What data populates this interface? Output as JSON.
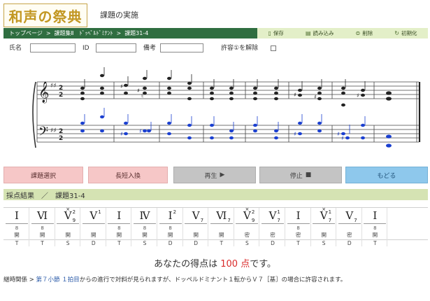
{
  "header": {
    "logo": "和声の祭典",
    "title": "課題の実施"
  },
  "breadcrumb": [
    "トップページ",
    "課題集Ⅱ　ﾄﾞｯﾍﾟﾙﾄﾞﾐﾅﾝﾄ",
    "課題31-4"
  ],
  "toolbar": [
    {
      "icon": "save-icon",
      "label": "保存"
    },
    {
      "icon": "load-icon",
      "label": "読み込み"
    },
    {
      "icon": "delete-icon",
      "label": "削除"
    },
    {
      "icon": "reset-icon",
      "label": "初期化"
    }
  ],
  "form": {
    "name_label": "氏名",
    "name_value": "",
    "id_label": "ID",
    "id_value": "",
    "note_label": "備考",
    "note_value": "",
    "allow_label": "許容①を解除"
  },
  "buttons": {
    "select": "課題選択",
    "transpose": "長短入換",
    "play": "再生",
    "stop": "停止",
    "back": "もどる"
  },
  "result": {
    "title": "採点結果",
    "sep": "／",
    "task": "課題31-4"
  },
  "analysis": [
    {
      "chord": "I",
      "sup": "",
      "sub": "",
      "mod": "",
      "pos": "8",
      "voice": "開",
      "func": "T"
    },
    {
      "chord": "Ⅵ",
      "sup": "",
      "sub": "",
      "mod": "",
      "pos": "8",
      "voice": "開",
      "func": "T"
    },
    {
      "chord": "V",
      "sup": "2",
      "sub": "9",
      "mod": "×",
      "pos": "",
      "voice": "開",
      "func": "S"
    },
    {
      "chord": "V",
      "sup": "1",
      "sub": "",
      "mod": "",
      "pos": "",
      "voice": "開",
      "func": "D"
    },
    {
      "chord": "I",
      "sup": "",
      "sub": "",
      "mod": "",
      "pos": "8",
      "voice": "開",
      "func": "T"
    },
    {
      "chord": "Ⅳ",
      "sup": "",
      "sub": "",
      "mod": "",
      "pos": "8",
      "voice": "開",
      "func": "S"
    },
    {
      "chord": "I",
      "sup": "2",
      "sub": "",
      "mod": "",
      "pos": "8",
      "voice": "開",
      "func": "D"
    },
    {
      "chord": "V",
      "sup": "",
      "sub": "7",
      "mod": "",
      "pos": "",
      "voice": "開",
      "func": "D"
    },
    {
      "chord": "Ⅵ",
      "sup": "",
      "sub": "7",
      "mod": "",
      "pos": "",
      "voice": "開",
      "func": "T"
    },
    {
      "chord": "V",
      "sup": "2",
      "sub": "9",
      "mod": "×",
      "pos": "",
      "voice": "密",
      "func": "S"
    },
    {
      "chord": "V",
      "sup": "1",
      "sub": "7",
      "mod": "",
      "pos": "",
      "voice": "密",
      "func": "D"
    },
    {
      "chord": "I",
      "sup": "",
      "sub": "",
      "mod": "",
      "pos": "8",
      "voice": "密",
      "func": "T"
    },
    {
      "chord": "V",
      "sup": "1",
      "sub": "7",
      "mod": "×",
      "pos": "",
      "voice": "開",
      "func": "S"
    },
    {
      "chord": "V",
      "sup": "",
      "sub": "7",
      "mod": "",
      "pos": "",
      "voice": "密",
      "func": "D"
    },
    {
      "chord": "I",
      "sup": "",
      "sub": "",
      "mod": "",
      "pos": "8",
      "voice": "開",
      "func": "T"
    }
  ],
  "score_msg": {
    "prefix": "あなたの得点は",
    "points": "100 点",
    "suffix": "です。"
  },
  "remark": {
    "prefix": "継時関係 > ",
    "location": "第７小節 １拍目",
    "text": "からの進行で対斜が見られますが、ドッペルドミナント１転からＶ７［基］の場合に許容されます。"
  },
  "colors": {
    "logo": "#c29722",
    "nav_bg": "#2f6e40",
    "nav_action_bg": "#e3efc8",
    "result_bg": "#d5e3b3",
    "points": "#d92a2a",
    "bass_notes": "#1a3fd0"
  }
}
